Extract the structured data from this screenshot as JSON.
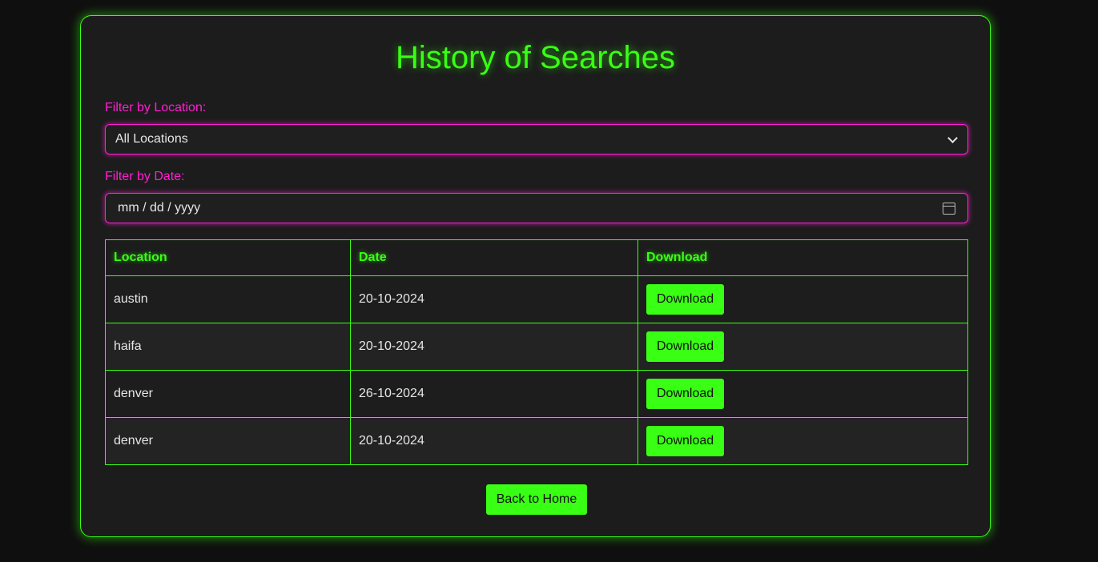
{
  "page": {
    "title": "History of Searches",
    "accent_color": "#39ff14",
    "filter_color": "#ff1fd1"
  },
  "filters": {
    "location_label": "Filter by Location:",
    "location_selected": "All Locations",
    "date_label": "Filter by Date:",
    "date_placeholder": "mm / dd / yyyy",
    "date_icon": "calendar-icon"
  },
  "table": {
    "headers": [
      "Location",
      "Date",
      "Download"
    ],
    "rows": [
      {
        "location": "austin",
        "date": "20-10-2024",
        "action": "Download"
      },
      {
        "location": "haifa",
        "date": "20-10-2024",
        "action": "Download"
      },
      {
        "location": "denver",
        "date": "26-10-2024",
        "action": "Download"
      },
      {
        "location": "denver",
        "date": "20-10-2024",
        "action": "Download"
      }
    ]
  },
  "footer": {
    "back_label": "Back to Home"
  }
}
